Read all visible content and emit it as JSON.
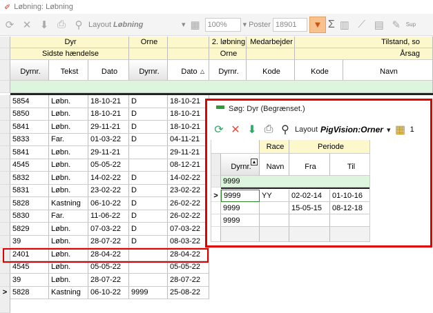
{
  "window": {
    "title": "Løbning: Løbning"
  },
  "toolbar": {
    "layout_label": "Layout",
    "layout_value": "Løbning",
    "zoom": "100%",
    "poster_label": "Poster",
    "poster_value": "18901",
    "sup_label": "Sup"
  },
  "grid": {
    "groups": {
      "dyr": "Dyr",
      "orne": "Orne",
      "lobning2": "2. løbning",
      "medarbejder": "Medarbejder",
      "tilstand": "Tilstand, so"
    },
    "subgroups": {
      "sidste": "Sidste hændelse",
      "orne": "Orne",
      "arsag": "Årsag"
    },
    "columns": {
      "dyrnr": "Dyrnr.",
      "tekst": "Tekst",
      "dato": "Dato",
      "orne_dyrnr": "Dyrnr.",
      "lob_dato": "Dato",
      "lob2_dyrnr": "Dyrnr.",
      "med_kode": "Kode",
      "til_kode": "Kode",
      "til_navn": "Navn"
    },
    "rows": [
      {
        "dyrnr": "5854",
        "tekst": "Løbn.",
        "dato": "18-10-21",
        "orne": "D",
        "ldato": "18-10-21"
      },
      {
        "dyrnr": "5850",
        "tekst": "Løbn.",
        "dato": "18-10-21",
        "orne": "D",
        "ldato": "18-10-21"
      },
      {
        "dyrnr": "5841",
        "tekst": "Løbn.",
        "dato": "29-11-21",
        "orne": "D",
        "ldato": "18-10-21"
      },
      {
        "dyrnr": "5833",
        "tekst": "Far.",
        "dato": "01-03-22",
        "orne": "D",
        "ldato": "04-11-21"
      },
      {
        "dyrnr": "5841",
        "tekst": "Løbn.",
        "dato": "29-11-21",
        "orne": "",
        "ldato": "29-11-21"
      },
      {
        "dyrnr": "4545",
        "tekst": "Løbn.",
        "dato": "05-05-22",
        "orne": "",
        "ldato": "08-12-21"
      },
      {
        "dyrnr": "5832",
        "tekst": "Løbn.",
        "dato": "14-02-22",
        "orne": "D",
        "ldato": "14-02-22"
      },
      {
        "dyrnr": "5831",
        "tekst": "Løbn.",
        "dato": "23-02-22",
        "orne": "D",
        "ldato": "23-02-22"
      },
      {
        "dyrnr": "5828",
        "tekst": "Kastning",
        "dato": "06-10-22",
        "orne": "D",
        "ldato": "26-02-22"
      },
      {
        "dyrnr": "5830",
        "tekst": "Far.",
        "dato": "11-06-22",
        "orne": "D",
        "ldato": "26-02-22"
      },
      {
        "dyrnr": "5829",
        "tekst": "Løbn.",
        "dato": "07-03-22",
        "orne": "D",
        "ldato": "07-03-22"
      },
      {
        "dyrnr": "39",
        "tekst": "Løbn.",
        "dato": "28-07-22",
        "orne": "D",
        "ldato": "08-03-22"
      },
      {
        "dyrnr": "2401",
        "tekst": "Løbn.",
        "dato": "28-04-22",
        "orne": "",
        "ldato": "28-04-22"
      },
      {
        "dyrnr": "4545",
        "tekst": "Løbn.",
        "dato": "05-05-22",
        "orne": "",
        "ldato": "05-05-22"
      },
      {
        "dyrnr": "39",
        "tekst": "Løbn.",
        "dato": "28-07-22",
        "orne": "",
        "ldato": "28-07-22"
      },
      {
        "dyrnr": "5828",
        "tekst": "Kastning",
        "dato": "06-10-22",
        "orne": "9999",
        "ldato": "25-08-22"
      }
    ],
    "current_row_marker": ">"
  },
  "popup": {
    "title": "Søg: Dyr (Begrænset.)",
    "layout_label": "Layout",
    "layout_value": "PigVision:Orner",
    "toolbar_num": "1",
    "groups": {
      "race": "Race",
      "periode": "Periode"
    },
    "columns": {
      "dyrnr": "Dyrnr.",
      "navn": "Navn",
      "fra": "Fra",
      "til": "Til"
    },
    "filter_value": "9999",
    "rows": [
      {
        "dyrnr": "9999",
        "navn": "YY",
        "fra": "02-02-14",
        "til": "01-10-16"
      },
      {
        "dyrnr": "9999",
        "navn": "",
        "fra": "15-05-15",
        "til": "08-12-18"
      },
      {
        "dyrnr": "9999",
        "navn": "",
        "fra": "",
        "til": ""
      }
    ],
    "current_row_marker": ">"
  },
  "colors": {
    "accent_red": "#e00000",
    "header_yellow": "#fcf8cc",
    "filter_green": "#ddf5dd",
    "filter_active": "#f7c28f"
  }
}
